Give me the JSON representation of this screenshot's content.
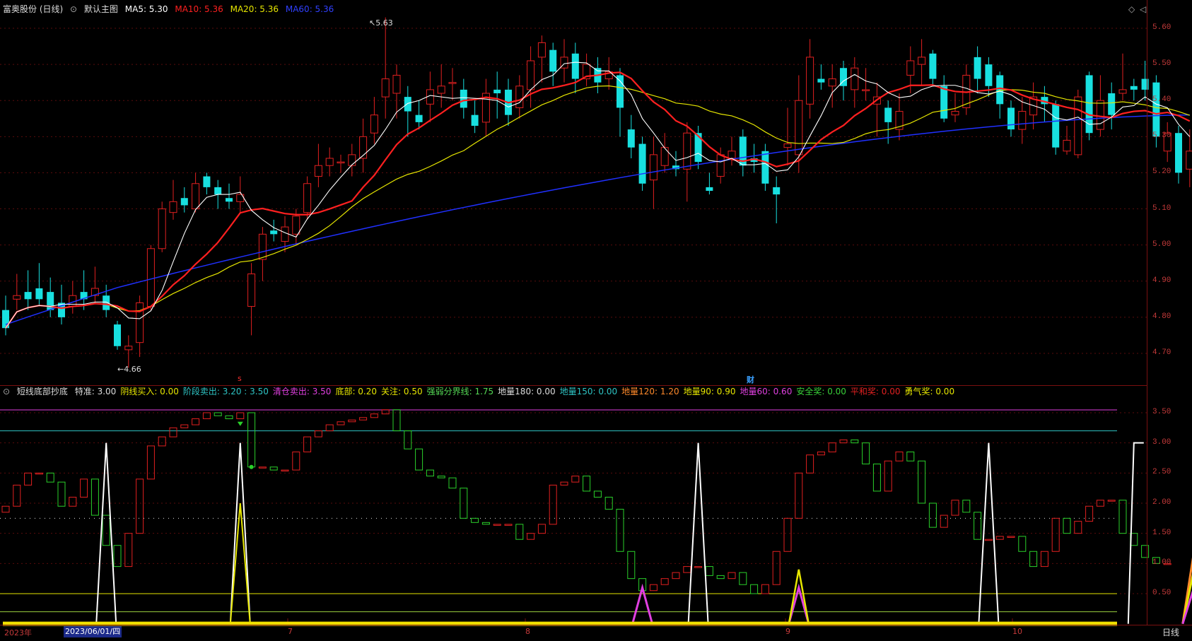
{
  "header": {
    "stock_name": "富奥股份 (日线)",
    "template": "默认主图",
    "ma5": "MA5: 5.30",
    "ma10": "MA10: 5.36",
    "ma20": "MA20: 5.36",
    "ma60": "MA60: 5.36"
  },
  "indicator": {
    "name": "短线底部抄底",
    "items": [
      {
        "text": "特准: 3.00",
        "color": "#dddddd"
      },
      {
        "text": "阴线买入: 0.00",
        "color": "#e6e600"
      },
      {
        "text": "阶段卖出: 3.20 : 3.50",
        "color": "#2ec4c4"
      },
      {
        "text": "清仓卖出: 3.50",
        "color": "#e040e0"
      },
      {
        "text": "底部: 0.20",
        "color": "#e6e600"
      },
      {
        "text": "关注: 0.50",
        "color": "#e6e600"
      },
      {
        "text": "强弱分界线: 1.75",
        "color": "#55d855"
      },
      {
        "text": "地量180: 0.00",
        "color": "#dddddd"
      },
      {
        "text": "地量150: 0.00",
        "color": "#2ec4c4"
      },
      {
        "text": "地量120: 1.20",
        "color": "#ff8a2a"
      },
      {
        "text": "地量90: 0.90",
        "color": "#e6e600"
      },
      {
        "text": "地量60: 0.60",
        "color": "#e040e0"
      },
      {
        "text": "安全奖: 0.00",
        "color": "#39d039"
      },
      {
        "text": "平和奖: 0.00",
        "color": "#e02020"
      },
      {
        "text": "勇气奖: 0.00",
        "color": "#e6e600"
      }
    ]
  },
  "price_axis": [
    "5.60",
    "5.50",
    "5.40",
    "5.30",
    "5.20",
    "5.10",
    "5.00",
    "4.90",
    "4.80",
    "4.70"
  ],
  "indicator_axis": [
    "3.50",
    "3.00",
    "2.50",
    "2.00",
    "1.50",
    "1.00",
    "0.50"
  ],
  "annotations": {
    "high": "5.63",
    "low": "4.66",
    "s_mark": "s",
    "cai_mark": "财"
  },
  "time_axis": {
    "year": "2023年",
    "selected_date": "2023/06/01/四",
    "months": [
      "7",
      "8",
      "9",
      "10"
    ]
  },
  "period_label": "日线",
  "colors": {
    "up": "#e02020",
    "down": "#18e0e0",
    "ma5": "#ffffff",
    "ma10": "#ff2020",
    "ma20": "#e6e600",
    "ma60": "#2030ff",
    "axis": "#7a1010"
  },
  "candles": [
    [
      4.82,
      4.77,
      4.86,
      4.75
    ],
    [
      4.85,
      4.86,
      4.92,
      4.82
    ],
    [
      4.87,
      4.85,
      4.93,
      4.82
    ],
    [
      4.88,
      4.85,
      4.95,
      4.83
    ],
    [
      4.87,
      4.82,
      4.91,
      4.8
    ],
    [
      4.84,
      4.8,
      4.89,
      4.78
    ],
    [
      4.83,
      4.86,
      4.9,
      4.81
    ],
    [
      4.87,
      4.85,
      4.93,
      4.82
    ],
    [
      4.86,
      4.88,
      4.94,
      4.84
    ],
    [
      4.86,
      4.82,
      4.89,
      4.8
    ],
    [
      4.78,
      4.72,
      4.79,
      4.71
    ],
    [
      4.71,
      4.72,
      4.75,
      4.66
    ],
    [
      4.73,
      4.84,
      4.86,
      4.69
    ],
    [
      4.83,
      4.99,
      5.0,
      4.82
    ],
    [
      4.99,
      5.1,
      5.12,
      4.98
    ],
    [
      5.09,
      5.12,
      5.18,
      5.07
    ],
    [
      5.13,
      5.11,
      5.16,
      5.09
    ],
    [
      5.1,
      5.17,
      5.2,
      5.09
    ],
    [
      5.19,
      5.16,
      5.2,
      5.14
    ],
    [
      5.16,
      5.14,
      5.18,
      5.1
    ],
    [
      5.13,
      5.12,
      5.17,
      5.1
    ],
    [
      5.12,
      5.14,
      5.19,
      5.09
    ],
    [
      4.83,
      4.92,
      4.95,
      4.75
    ],
    [
      4.96,
      5.03,
      5.05,
      4.9
    ],
    [
      5.04,
      5.03,
      5.07,
      5.01
    ],
    [
      5.01,
      5.05,
      5.08,
      4.98
    ],
    [
      5.03,
      5.08,
      5.1,
      5.0
    ],
    [
      5.09,
      5.17,
      5.19,
      5.07
    ],
    [
      5.19,
      5.22,
      5.28,
      5.16
    ],
    [
      5.22,
      5.24,
      5.27,
      5.19
    ],
    [
      5.23,
      5.23,
      5.25,
      5.2
    ],
    [
      5.22,
      5.25,
      5.28,
      5.19
    ],
    [
      5.24,
      5.3,
      5.35,
      5.2
    ],
    [
      5.31,
      5.36,
      5.41,
      5.28
    ],
    [
      5.41,
      5.46,
      5.63,
      5.35
    ],
    [
      5.42,
      5.47,
      5.5,
      5.35
    ],
    [
      5.41,
      5.37,
      5.44,
      5.3
    ],
    [
      5.36,
      5.34,
      5.4,
      5.32
    ],
    [
      5.39,
      5.43,
      5.48,
      5.34
    ],
    [
      5.42,
      5.44,
      5.5,
      5.38
    ],
    [
      5.45,
      5.45,
      5.49,
      5.4
    ],
    [
      5.43,
      5.38,
      5.46,
      5.35
    ],
    [
      5.36,
      5.33,
      5.4,
      5.31
    ],
    [
      5.34,
      5.42,
      5.46,
      5.3
    ],
    [
      5.43,
      5.42,
      5.48,
      5.35
    ],
    [
      5.43,
      5.36,
      5.46,
      5.33
    ],
    [
      5.38,
      5.44,
      5.47,
      5.35
    ],
    [
      5.43,
      5.51,
      5.55,
      5.38
    ],
    [
      5.52,
      5.56,
      5.58,
      5.45
    ],
    [
      5.54,
      5.48,
      5.56,
      5.44
    ],
    [
      5.49,
      5.52,
      5.57,
      5.45
    ],
    [
      5.53,
      5.46,
      5.56,
      5.42
    ],
    [
      5.46,
      5.5,
      5.53,
      5.44
    ],
    [
      5.49,
      5.45,
      5.52,
      5.42
    ],
    [
      5.46,
      5.48,
      5.52,
      5.43
    ],
    [
      5.47,
      5.38,
      5.49,
      5.3
    ],
    [
      5.32,
      5.27,
      5.36,
      5.24
    ],
    [
      5.28,
      5.17,
      5.3,
      5.15
    ],
    [
      5.18,
      5.25,
      5.3,
      5.1
    ],
    [
      5.22,
      5.27,
      5.31,
      5.2
    ],
    [
      5.22,
      5.21,
      5.26,
      5.19
    ],
    [
      5.21,
      5.31,
      5.34,
      5.12
    ],
    [
      5.31,
      5.23,
      5.33,
      5.21
    ],
    [
      5.16,
      5.15,
      5.2,
      5.14
    ],
    [
      5.19,
      5.25,
      5.27,
      5.17
    ],
    [
      5.24,
      5.26,
      5.3,
      5.22
    ],
    [
      5.3,
      5.22,
      5.32,
      5.19
    ],
    [
      5.24,
      5.23,
      5.28,
      5.2
    ],
    [
      5.26,
      5.17,
      5.28,
      5.15
    ],
    [
      5.16,
      5.14,
      5.19,
      5.06
    ],
    [
      5.27,
      5.28,
      5.38,
      5.22
    ],
    [
      5.25,
      5.4,
      5.47,
      5.2
    ],
    [
      5.39,
      5.52,
      5.57,
      5.35
    ],
    [
      5.46,
      5.45,
      5.5,
      5.43
    ],
    [
      5.44,
      5.46,
      5.5,
      5.38
    ],
    [
      5.49,
      5.44,
      5.51,
      5.4
    ],
    [
      5.43,
      5.49,
      5.52,
      5.38
    ],
    [
      5.43,
      5.43,
      5.49,
      5.4
    ],
    [
      5.39,
      5.41,
      5.45,
      5.3
    ],
    [
      5.38,
      5.34,
      5.4,
      5.28
    ],
    [
      5.32,
      5.37,
      5.42,
      5.29
    ],
    [
      5.47,
      5.51,
      5.55,
      5.42
    ],
    [
      5.5,
      5.52,
      5.57,
      5.44
    ],
    [
      5.53,
      5.46,
      5.54,
      5.44
    ],
    [
      5.44,
      5.35,
      5.47,
      5.34
    ],
    [
      5.36,
      5.37,
      5.42,
      5.34
    ],
    [
      5.38,
      5.47,
      5.5,
      5.36
    ],
    [
      5.52,
      5.46,
      5.55,
      5.42
    ],
    [
      5.5,
      5.44,
      5.52,
      5.41
    ],
    [
      5.47,
      5.39,
      5.48,
      5.35
    ],
    [
      5.38,
      5.32,
      5.4,
      5.3
    ],
    [
      5.32,
      5.37,
      5.41,
      5.28
    ],
    [
      5.36,
      5.41,
      5.45,
      5.32
    ],
    [
      5.41,
      5.39,
      5.44,
      5.34
    ],
    [
      5.39,
      5.27,
      5.4,
      5.25
    ],
    [
      5.26,
      5.29,
      5.33,
      5.25
    ],
    [
      5.25,
      5.41,
      5.43,
      5.24
    ],
    [
      5.47,
      5.31,
      5.48,
      5.29
    ],
    [
      5.32,
      5.4,
      5.47,
      5.3
    ],
    [
      5.42,
      5.36,
      5.45,
      5.32
    ],
    [
      5.42,
      5.43,
      5.53,
      5.4
    ],
    [
      5.44,
      5.43,
      5.46,
      5.4
    ],
    [
      5.46,
      5.43,
      5.51,
      5.4
    ],
    [
      5.45,
      5.3,
      5.47,
      5.27
    ],
    [
      5.26,
      5.31,
      5.34,
      5.23
    ],
    [
      5.31,
      5.2,
      5.33,
      5.17
    ],
    [
      5.21,
      5.26,
      5.32,
      5.16
    ]
  ],
  "indicator_series": [
    1.95,
    2.3,
    2.5,
    2.5,
    2.35,
    1.95,
    2.1,
    2.4,
    1.8,
    1.3,
    0.95,
    1.5,
    2.4,
    2.95,
    3.1,
    3.25,
    3.3,
    3.4,
    3.5,
    3.45,
    3.4,
    3.5,
    2.6,
    2.6,
    2.55,
    2.55,
    2.85,
    3.1,
    3.2,
    3.3,
    3.35,
    3.38,
    3.42,
    3.48,
    3.55,
    3.2,
    2.9,
    2.55,
    2.45,
    2.42,
    2.25,
    1.75,
    1.68,
    1.65,
    1.65,
    1.65,
    1.4,
    1.5,
    1.65,
    2.3,
    2.35,
    2.45,
    2.2,
    2.1,
    1.9,
    1.2,
    0.75,
    0.55,
    0.65,
    0.75,
    0.85,
    0.95,
    0.95,
    0.8,
    0.75,
    0.85,
    0.65,
    0.5,
    0.65,
    1.2,
    1.75,
    2.5,
    2.8,
    2.85,
    3.0,
    3.05,
    3.0,
    2.65,
    2.2,
    2.7,
    2.85,
    2.7,
    2.0,
    1.6,
    1.8,
    2.05,
    1.85,
    1.4,
    1.4,
    1.45,
    1.45,
    1.2,
    0.95,
    1.2,
    1.75,
    1.5,
    1.7,
    1.95,
    2.05,
    2.05,
    1.5,
    1.3,
    1.1,
    1.0,
    1.0
  ],
  "white_spikes": [
    9,
    21,
    62,
    88,
    101
  ],
  "yellow_spike": 21,
  "magenta_spikes": [
    57,
    71
  ],
  "yellow_small_spike": 71
}
